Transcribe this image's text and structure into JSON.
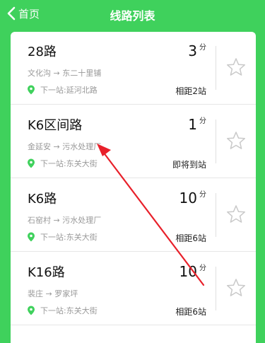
{
  "header": {
    "back_label": "首页",
    "title": "线路列表"
  },
  "routes": [
    {
      "name": "28路",
      "path": "文化沟 → 东二十里铺",
      "next_stop": "下一站:延河北路",
      "time": "3",
      "unit": "分",
      "distance": "相距2站"
    },
    {
      "name": "K6区间路",
      "path": "金延安 → 污水处理厂",
      "next_stop": "下一站:东关大街",
      "time": "1",
      "unit": "分",
      "distance": "即将到站"
    },
    {
      "name": "K6路",
      "path": "石窑村 → 污水处理厂",
      "next_stop": "下一站:东关大街",
      "time": "10",
      "unit": "分",
      "distance": "相距6站"
    },
    {
      "name": "K16路",
      "path": "裴庄 → 罗家坪",
      "next_stop": "下一站:东关大街",
      "time": "10",
      "unit": "分",
      "distance": "相距6站"
    }
  ],
  "colors": {
    "brand_green": "#3fd15c",
    "annotation_red": "#e8202a"
  },
  "icons": {
    "back": "chevron-left-icon",
    "location": "location-pin-icon",
    "favorite": "star-outline-icon"
  }
}
